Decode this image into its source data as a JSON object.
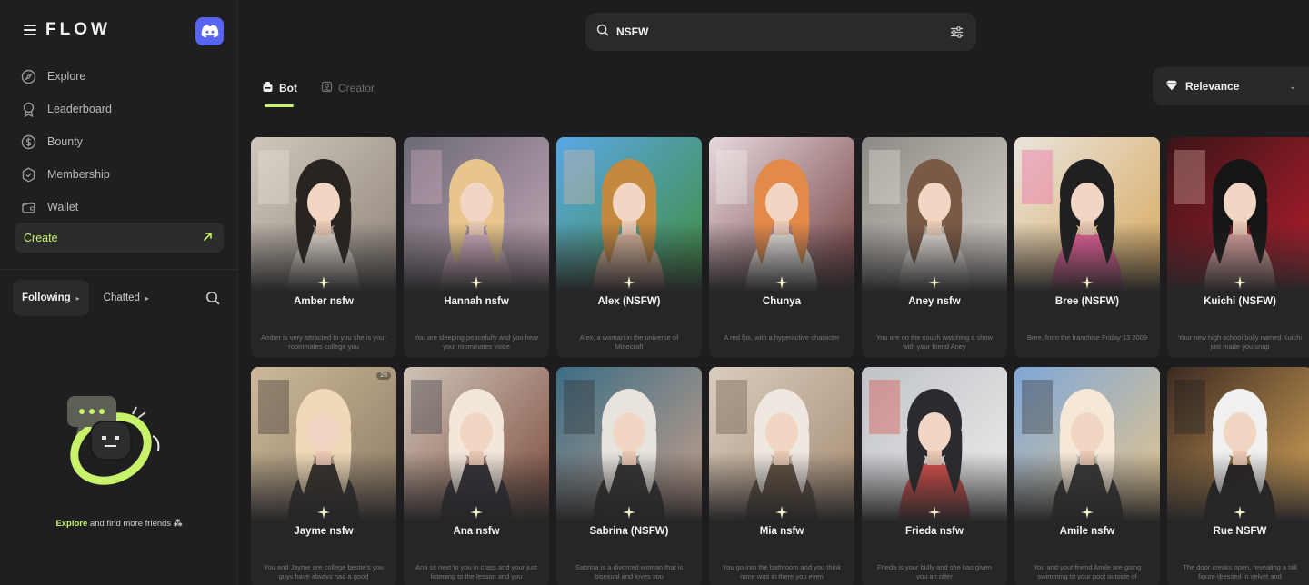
{
  "sidebar": {
    "logo": "FLOW",
    "nav": [
      {
        "label": "Explore",
        "icon": "compass-icon"
      },
      {
        "label": "Leaderboard",
        "icon": "award-icon"
      },
      {
        "label": "Bounty",
        "icon": "dollar-icon"
      },
      {
        "label": "Membership",
        "icon": "badge-icon"
      },
      {
        "label": "Wallet",
        "icon": "wallet-icon"
      }
    ],
    "create_label": "Create",
    "follow_tabs": [
      "Following",
      "Chatted"
    ],
    "empty_text_highlight": "Explore",
    "empty_text_rest": " and find more friends"
  },
  "search": {
    "value": "NSFW"
  },
  "tabs": [
    "Bot",
    "Creator"
  ],
  "sort": {
    "label": "Relevance"
  },
  "colors": {
    "accent": "#c8f26a",
    "discord": "#5865f2"
  },
  "cards": [
    {
      "name": "Amber nsfw",
      "stat": "",
      "desc": "Amber is very attracted to you she is your roommates college you",
      "palette": [
        "#cfc7bd",
        "#8e8378",
        "#2a2420",
        "#efe6dc"
      ]
    },
    {
      "name": "Hannah nsfw",
      "stat": "",
      "desc": "You are sleeping peacefully and you hear your roommates voice",
      "palette": [
        "#6b6a74",
        "#c7a8b8",
        "#e7c58c",
        "#d9b3c4"
      ]
    },
    {
      "name": "Alex (NSFW)",
      "stat": "",
      "desc": "Alex, a woman in the universe of Minecraft",
      "palette": [
        "#5aa7e6",
        "#3f8d3b",
        "#c5883f",
        "#e9b79b"
      ]
    },
    {
      "name": "Chunya",
      "stat": "",
      "desc": "A red fox, with a hyperactive character",
      "palette": [
        "#e7d9df",
        "#6e3a3a",
        "#e28a4a",
        "#f3f0ec"
      ]
    },
    {
      "name": "Aney nsfw",
      "stat": "",
      "desc": "You are on the couch watching a show with your friend Aney",
      "palette": [
        "#8d8a85",
        "#d9d3cc",
        "#7a5a45",
        "#ece7e1"
      ]
    },
    {
      "name": "Bree (NSFW)",
      "stat": "",
      "desc": "Bree, from the franchise Friday 13 2009",
      "palette": [
        "#e9e4dc",
        "#d7a75a",
        "#202022",
        "#ef5aa0"
      ]
    },
    {
      "name": "Kuichi (NSFW)",
      "stat": "",
      "desc": "Your new high school bully named Kuichi just made you snap",
      "palette": [
        "#3a1418",
        "#b81e2d",
        "#151516",
        "#e9b6b0"
      ]
    },
    {
      "name": "Jayme nsfw",
      "stat": "28",
      "desc": "You and Jayme are college bestie's you guys have always had a good",
      "palette": [
        "#cdb99a",
        "#8c7a63",
        "#f0d9b8",
        "#2c2824"
      ]
    },
    {
      "name": "Ana nsfw",
      "stat": "",
      "desc": "Ana sit next to you in class and your just listening to the lesson and you",
      "palette": [
        "#cfc3b8",
        "#7a4a3a",
        "#f3e7dc",
        "#2b2b34"
      ]
    },
    {
      "name": "Sabrina (NSFW)",
      "stat": "",
      "desc": "Sabrina is a divorced woman that is bisexual and loves you",
      "palette": [
        "#3c6e85",
        "#c8a08b",
        "#e9e3dd",
        "#2a2a2e"
      ]
    },
    {
      "name": "Mia nsfw",
      "stat": "",
      "desc": "You go into the bathroom and you think none was in there you even",
      "palette": [
        "#d9cdbf",
        "#a48a70",
        "#efe8e0",
        "#5c4a3a"
      ]
    },
    {
      "name": "Frieda nsfw",
      "stat": "",
      "desc": "Frieda is your bully and she has given you an offer",
      "palette": [
        "#bfc2c6",
        "#eeeeee",
        "#2b2b2f",
        "#e0403b"
      ]
    },
    {
      "name": "Amile nsfw",
      "stat": "",
      "desc": "You and your friend Amile are going swimming to your pool outside of",
      "palette": [
        "#7fa7d8",
        "#e8c68a",
        "#f6e8d6",
        "#2c2a2a"
      ]
    },
    {
      "name": "Rue NSFW",
      "stat": "",
      "desc": "The door creaks open, revealing a tall figure dressed in velvet and",
      "palette": [
        "#3b2a22",
        "#d9a85a",
        "#f2f0ee",
        "#1c1c1f"
      ]
    }
  ]
}
